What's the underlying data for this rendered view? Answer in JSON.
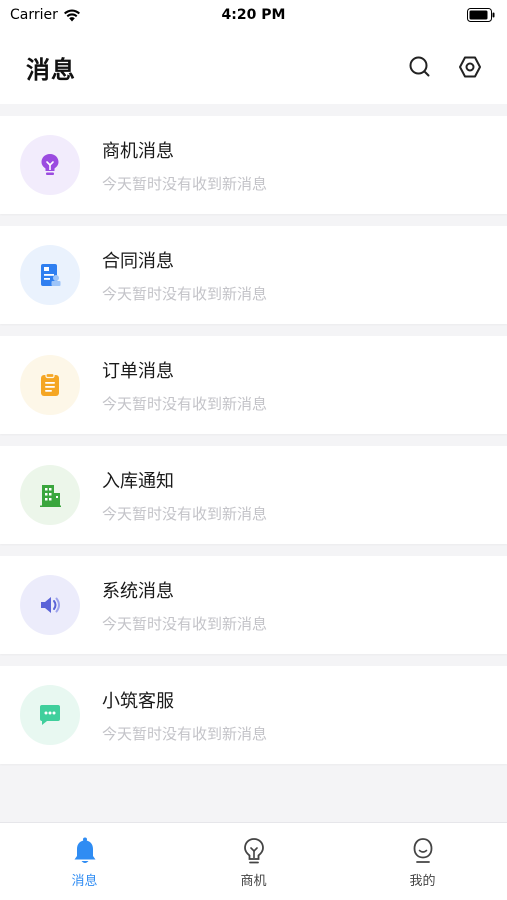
{
  "status_bar": {
    "carrier": "Carrier",
    "time": "4:20 PM"
  },
  "header": {
    "title": "消息"
  },
  "messages": [
    {
      "title": "商机消息",
      "subtitle": "今天暂时没有收到新消息",
      "icon": "lightbulb-icon",
      "color": "#9b4be0",
      "bg": "#f2ecfc"
    },
    {
      "title": "合同消息",
      "subtitle": "今天暂时没有收到新消息",
      "icon": "contract-icon",
      "color": "#2f7ff0",
      "bg": "#eaf2fd"
    },
    {
      "title": "订单消息",
      "subtitle": "今天暂时没有收到新消息",
      "icon": "clipboard-icon",
      "color": "#f5a623",
      "bg": "#fdf7e8"
    },
    {
      "title": "入库通知",
      "subtitle": "今天暂时没有收到新消息",
      "icon": "building-icon",
      "color": "#3aa63d",
      "bg": "#ecf6ea"
    },
    {
      "title": "系统消息",
      "subtitle": "今天暂时没有收到新消息",
      "icon": "speaker-icon",
      "color": "#5a63d8",
      "bg": "#ececfb"
    },
    {
      "title": "小筑客服",
      "subtitle": "今天暂时没有收到新消息",
      "icon": "chat-icon",
      "color": "#3fcf9c",
      "bg": "#e8f8f1"
    }
  ],
  "tab_bar": {
    "tabs": [
      {
        "label": "消息",
        "icon": "bell-icon",
        "active": true
      },
      {
        "label": "商机",
        "icon": "lightbulb-icon",
        "active": false
      },
      {
        "label": "我的",
        "icon": "user-icon",
        "active": false
      }
    ]
  },
  "colors": {
    "accent": "#2f8cf3",
    "background": "#f4f4f6"
  }
}
